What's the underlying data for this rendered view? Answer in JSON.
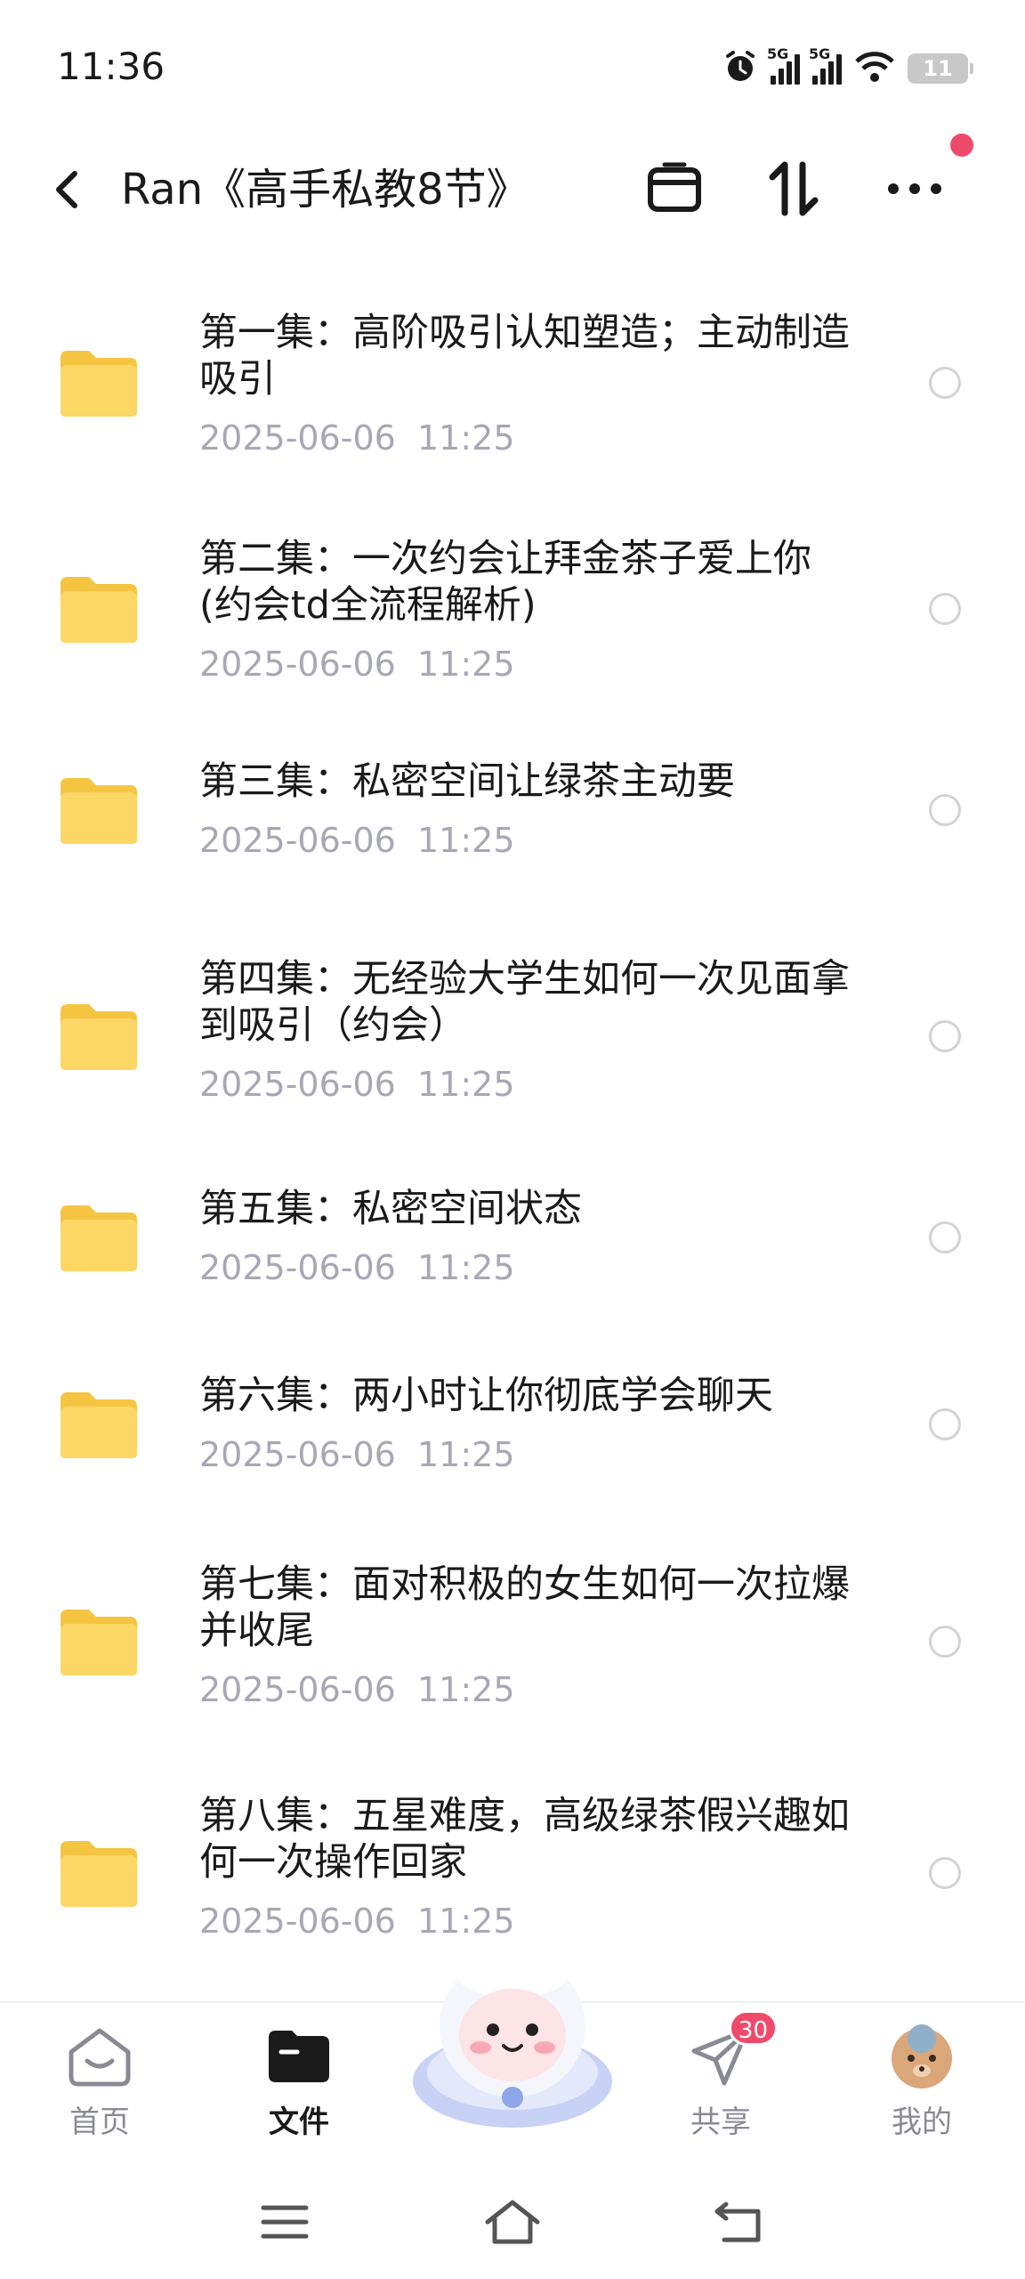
{
  "status_bar": {
    "time": "11:36",
    "net1": "5G",
    "net2": "5G",
    "battery": "11",
    "icons": [
      "alarm-icon",
      "signal-icon",
      "signal-icon",
      "wifi-icon",
      "battery-icon"
    ]
  },
  "header": {
    "title": "Ran《高手私教8节》",
    "back_icon": "chevron-left-icon",
    "actions": [
      "archive-icon",
      "sort-icon",
      "more-icon"
    ],
    "notification_dot_color": "#f04a6a"
  },
  "files": [
    {
      "name": "第一集：高阶吸引认知塑造；主动制造吸引",
      "date": "2025-06-06  11:25"
    },
    {
      "name": "第二集：一次约会让拜金茶子爱上你(约会td全流程解析)",
      "date": "2025-06-06  11:25"
    },
    {
      "name": "第三集：私密空间让绿茶主动要",
      "date": "2025-06-06  11:25"
    },
    {
      "name": "第四集：无经验大学生如何一次见面拿到吸引（约会）",
      "date": "2025-06-06  11:25"
    },
    {
      "name": "第五集：私密空间状态",
      "date": "2025-06-06  11:25"
    },
    {
      "name": "第六集：两小时让你彻底学会聊天",
      "date": "2025-06-06  11:25"
    },
    {
      "name": "第七集：面对积极的女生如何一次拉爆并收尾",
      "date": "2025-06-06  11:25"
    },
    {
      "name": "第八集：五星难度，高级绿茶假兴趣如何一次操作回家",
      "date": "2025-06-06  11:25"
    }
  ],
  "tabs": [
    {
      "label": "首页",
      "icon": "home-icon",
      "active": false
    },
    {
      "label": "文件",
      "icon": "folder-icon",
      "active": true
    },
    {
      "label": "共享",
      "icon": "send-icon",
      "active": false,
      "badge": "30"
    },
    {
      "label": "我的",
      "icon": "avatar-icon",
      "active": false
    }
  ],
  "nav": [
    "menu-icon",
    "home-icon",
    "back-icon"
  ],
  "colors": {
    "folder": "#fcd34d",
    "accent_red": "#f04a6a",
    "date_gray": "#a8a8b4"
  }
}
